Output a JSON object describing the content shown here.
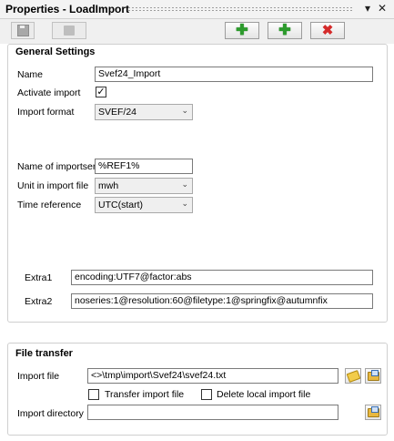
{
  "window": {
    "title": "Properties - LoadImport",
    "pin_glyph": "▾",
    "close_glyph": "✕"
  },
  "toolbar": {
    "save_icon": "save-icon",
    "copy_icon": "copy-icon",
    "add_copy_icon": "add-copy-icon",
    "add_icon": "add-icon",
    "delete_icon": "delete-icon"
  },
  "general": {
    "title": "General Settings",
    "name_label": "Name",
    "name_value": "Svef24_Import",
    "activate_label": "Activate import",
    "activate_checked": "✓",
    "format_label": "Import format",
    "format_value": "SVEF/24",
    "series_label": "Name of importserie",
    "series_value": "%REF1%",
    "unit_label": "Unit in import file",
    "unit_value": "mwh",
    "timeref_label": "Time reference",
    "timeref_value": "UTC(start)",
    "extra1_label": "Extra1",
    "extra1_value": "encoding:UTF7@factor:abs",
    "extra2_label": "Extra2",
    "extra2_value": "noseries:1@resolution:60@filetype:1@springfix@autumnfix",
    "chevron": "⌄"
  },
  "transfer": {
    "title": "File transfer",
    "import_file_label": "Import file",
    "import_file_value": "<>\\tmp\\import\\Svef24\\svef24.txt",
    "transfer_label": "Transfer import file",
    "delete_label": "Delete local import file",
    "dir_label": "Import directory",
    "dir_value": ""
  }
}
